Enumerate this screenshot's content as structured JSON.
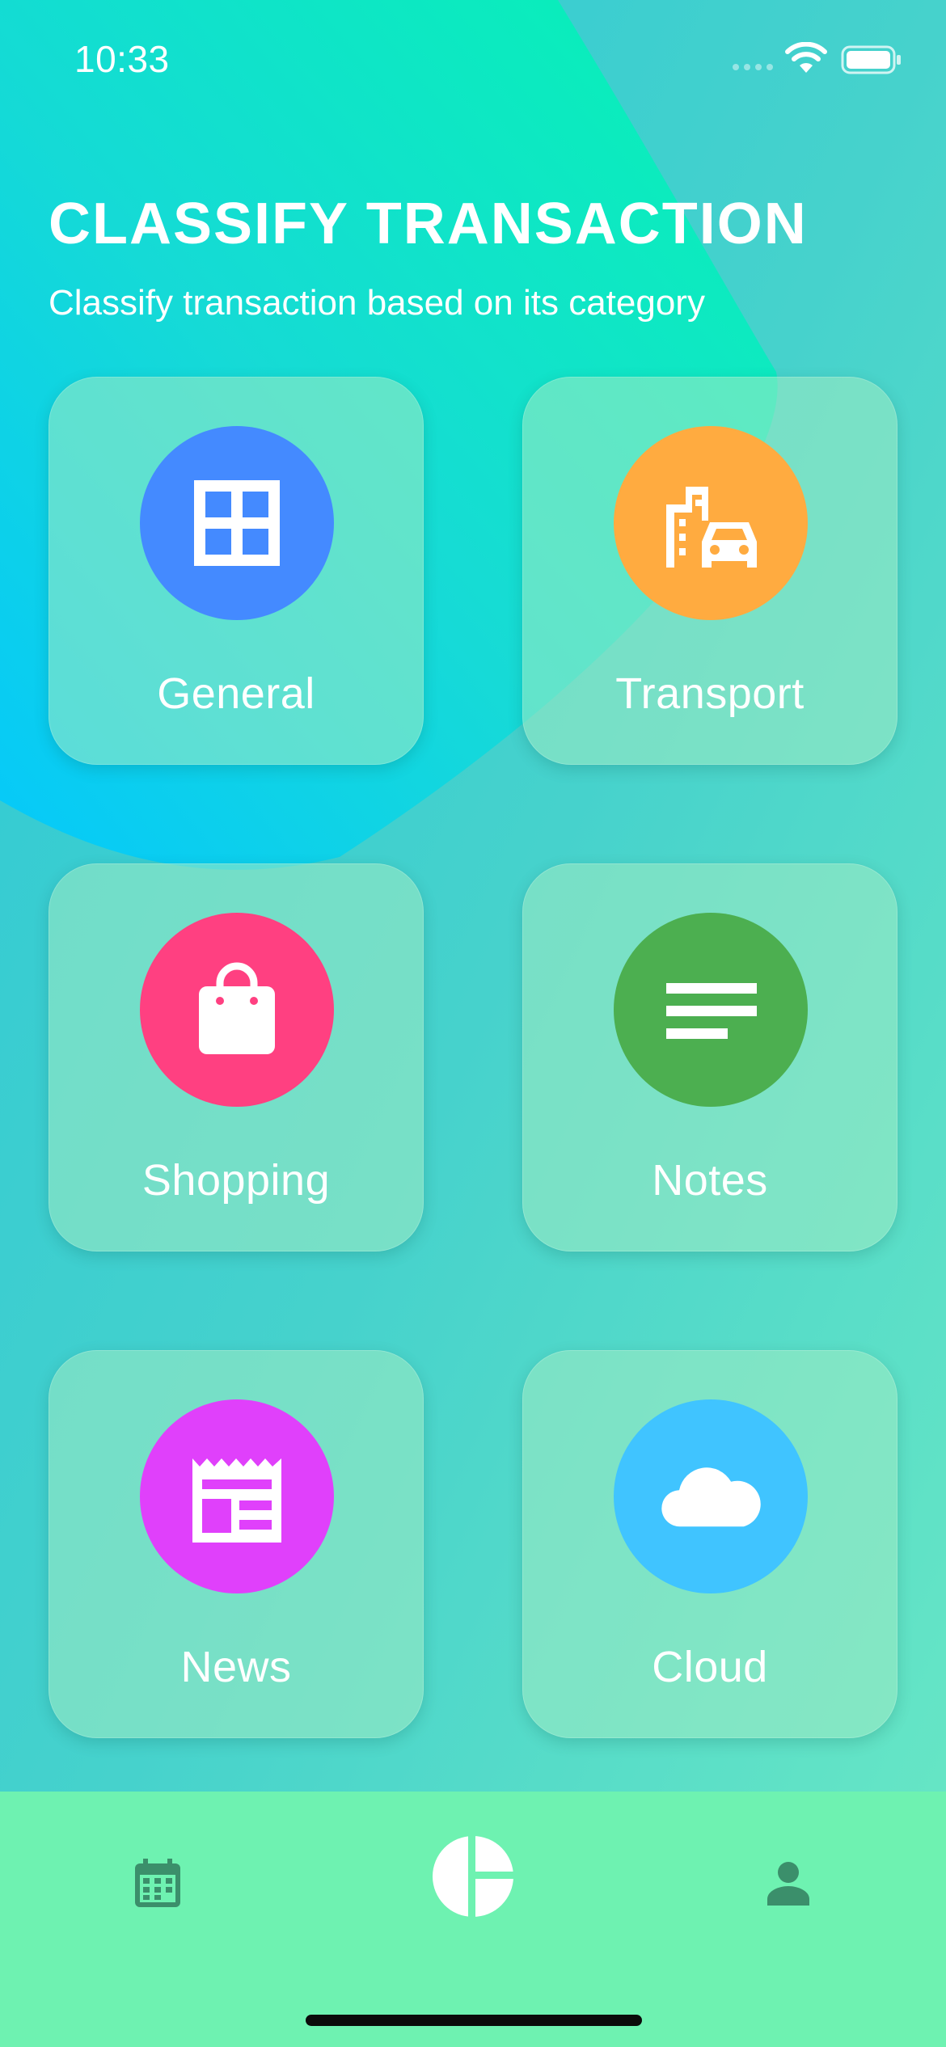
{
  "status_bar": {
    "time": "10:33"
  },
  "header": {
    "title": "CLASSIFY TRANSACTION",
    "subtitle": "Classify transaction based on its category"
  },
  "categories": [
    {
      "label": "General",
      "icon": "grid-icon",
      "color": "#448aff"
    },
    {
      "label": "Transport",
      "icon": "transport-icon",
      "color": "#ffab40"
    },
    {
      "label": "Shopping",
      "icon": "shopping-bag-icon",
      "color": "#ff4081"
    },
    {
      "label": "Notes",
      "icon": "notes-icon",
      "color": "#4caf50"
    },
    {
      "label": "News",
      "icon": "newspaper-icon",
      "color": "#e040fb"
    },
    {
      "label": "Cloud",
      "icon": "cloud-icon",
      "color": "#40c4ff"
    }
  ],
  "bottom_nav": {
    "items": [
      {
        "icon": "calendar-icon"
      },
      {
        "icon": "pie-chart-icon"
      },
      {
        "icon": "profile-icon"
      }
    ],
    "background": "#6ef2b1",
    "inactive_color": "#3b8f6b"
  }
}
